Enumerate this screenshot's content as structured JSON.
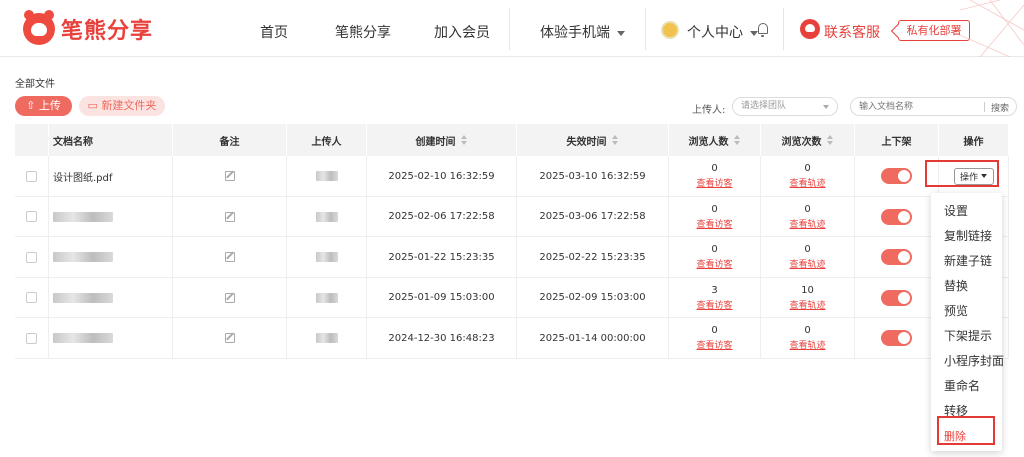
{
  "brand": {
    "name": "笔熊分享",
    "accent": "#e8413c"
  },
  "nav": {
    "home": "首页",
    "share": "笔熊分享",
    "member": "加入会员",
    "mobile": "体验手机端",
    "user_center": "个人中心",
    "service": "联系客服",
    "private_deploy": "私有化部署"
  },
  "toolbar": {
    "breadcrumb": "全部文件",
    "upload": "上传",
    "new_folder": "新建文件夹",
    "uploader_label": "上传人:",
    "team_placeholder": "请选择团队",
    "search_placeholder": "输入文档名称",
    "search_button": "搜索"
  },
  "table": {
    "headers": [
      "文档名称",
      "备注",
      "上传人",
      "创建时间",
      "失效时间",
      "浏览人数",
      "浏览次数",
      "上下架",
      "操作"
    ],
    "rows": [
      {
        "name": "设计图纸.pdf",
        "created": "2025-02-10 16:32:59",
        "expires": "2025-03-10 16:32:59",
        "visitors": "0",
        "views": "0"
      },
      {
        "name": "",
        "created": "2025-02-06 17:22:58",
        "expires": "2025-03-06 17:22:58",
        "visitors": "0",
        "views": "0"
      },
      {
        "name": "",
        "created": "2025-01-22 15:23:35",
        "expires": "2025-02-22 15:23:35",
        "visitors": "0",
        "views": "0"
      },
      {
        "name": "",
        "created": "2025-01-09 15:03:00",
        "expires": "2025-02-09 15:03:00",
        "visitors": "3",
        "views": "10"
      },
      {
        "name": "",
        "created": "2024-12-30 16:48:23",
        "expires": "2025-01-14 00:00:00",
        "visitors": "0",
        "views": "0"
      }
    ],
    "visitors_link": "查看访客",
    "views_link": "查看轨迹",
    "action_button": "操作"
  },
  "menu": {
    "items": [
      "设置",
      "复制链接",
      "新建子链",
      "替换",
      "预览",
      "下架提示",
      "小程序封面",
      "重命名",
      "转移",
      "删除"
    ]
  }
}
